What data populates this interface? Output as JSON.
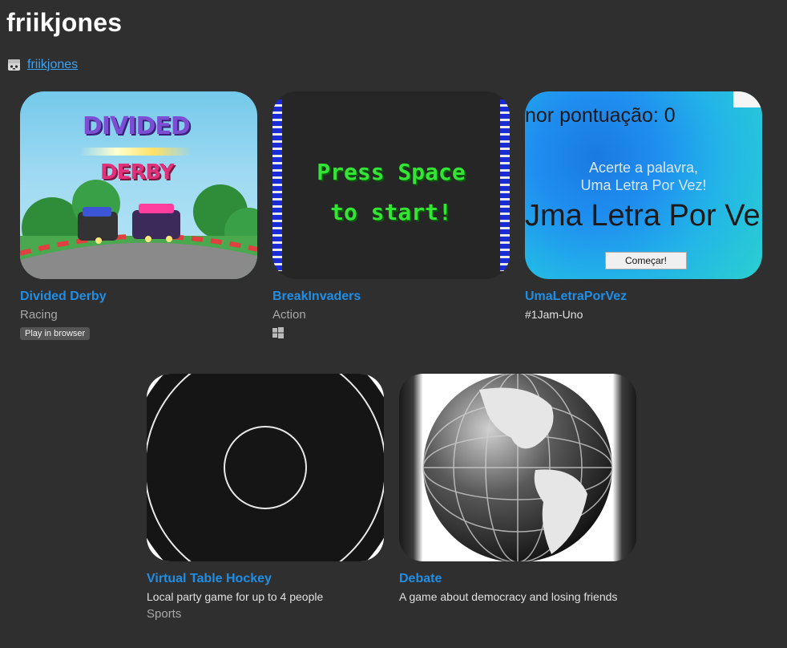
{
  "page": {
    "title": "friikjones",
    "profile_link": "friikjones"
  },
  "colors": {
    "background": "#2f2f2f",
    "link": "#1f8ee6",
    "muted": "#a8a8a8"
  },
  "games": [
    {
      "title": "Divided Derby",
      "genre": "Racing",
      "badge": "Play in browser",
      "thumb": {
        "logo_line1": "DIVIDED",
        "logo_line2": "DERBY"
      }
    },
    {
      "title": "BreakInvaders",
      "genre": "Action",
      "platform_icon": "windows-icon",
      "thumb": {
        "line1": "Press Space",
        "line2": "to start!"
      }
    },
    {
      "title": "UmaLetraPorVez",
      "desc": "#1Jam-Uno",
      "thumb": {
        "score": "nor pontuação: 0",
        "hint1": "Acerte a palavra,",
        "hint2": "Uma Letra Por Vez!",
        "big": "Jma Letra Por Ve",
        "button": "Começar!"
      }
    },
    {
      "title": "Virtual Table Hockey",
      "desc": "Local party game for up to 4 people",
      "genre": "Sports"
    },
    {
      "title": "Debate",
      "desc": "A game about democracy and losing friends"
    }
  ]
}
